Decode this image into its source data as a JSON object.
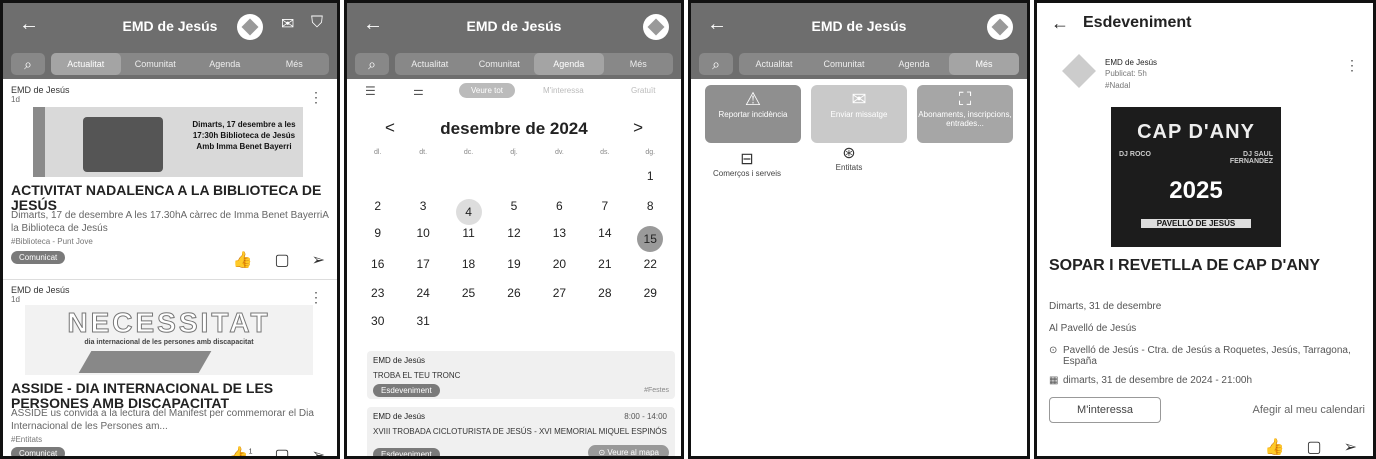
{
  "screens": [
    {
      "title": "EMD de Jesús",
      "tabs": [
        "Actualitat",
        "Comunitat",
        "Agenda",
        "Més"
      ],
      "posts": [
        {
          "author": "EMD de Jesús",
          "time": "1d",
          "image_text": "Dimarts, 17 desembre a les 17:30h Biblioteca de Jesús Amb Imma Benet Bayerri",
          "title": "ACTIVITAT NADALENCA A LA BIBLIOTECA DE JESÚS",
          "desc": "Dimarts, 17 de desembre A les 17.30hA càrrec de Imma Benet BayerriA la Biblioteca de Jesús",
          "tag": "#Biblioteca - Punt Jove",
          "badge": "Comunicat"
        },
        {
          "author": "EMD de Jesús",
          "time": "1d",
          "image_title": "NECESSITAT",
          "image_sub": "dia internacional de les persones amb discapacitat",
          "title": "ASSIDE - DIA INTERNACIONAL DE LES PERSONES AMB DISCAPACITAT",
          "desc": "ASSIDE us convida a la lectura del Manifest per commemorar el Dia Internacional de les Persones am...",
          "tag": "#Entitats",
          "badge": "Comunicat",
          "likes": "1"
        }
      ]
    },
    {
      "title": "EMD de Jesús",
      "tabs": [
        "Actualitat",
        "Comunitat",
        "Agenda",
        "Més"
      ],
      "filters": [
        "Veure tot",
        "M'interessa",
        "Gratuït"
      ],
      "month": "desembre de 2024",
      "dow": [
        "dl.",
        "dt.",
        "dc.",
        "dj.",
        "dv.",
        "ds.",
        "dg."
      ],
      "weeks": [
        [
          "",
          "",
          "",
          "",
          "",
          "",
          "1"
        ],
        [
          "2",
          "3",
          "4",
          "5",
          "6",
          "7",
          "8"
        ],
        [
          "9",
          "10",
          "11",
          "12",
          "13",
          "14",
          "15"
        ],
        [
          "16",
          "17",
          "18",
          "19",
          "20",
          "21",
          "22"
        ],
        [
          "23",
          "24",
          "25",
          "26",
          "27",
          "28",
          "29"
        ],
        [
          "30",
          "31",
          "",
          "",
          "",
          "",
          ""
        ]
      ],
      "events": [
        {
          "author": "EMD de Jesús",
          "title": "TROBA EL TEU TRONC",
          "badge": "Esdeveniment",
          "tag": "#Festes"
        },
        {
          "author": "EMD de Jesús",
          "time": "8:00 - 14:00",
          "title": "XVIII TROBADA CICLOTURISTA DE JESÚS - XVI MEMORIAL MIQUEL ESPINÓS",
          "badge": "Esdeveniment",
          "map": "Veure al mapa"
        }
      ]
    },
    {
      "title": "EMD de Jesús",
      "tabs": [
        "Actualitat",
        "Comunitat",
        "Agenda",
        "Més"
      ],
      "tiles": [
        "Reportar incidència",
        "Enviar missatge",
        "Abonaments, inscripcions, entrades..."
      ],
      "items": [
        "Comerços i serveis",
        "Entitats"
      ]
    },
    {
      "header": "Esdeveniment",
      "author": "EMD de Jesús",
      "published": "Publicat: 5h",
      "tag": "#Nadal",
      "poster_title": "CAP D'ANY",
      "poster_year": "2025",
      "poster_sub": "PAVELLÓ DE JESÚS",
      "poster_dj1": "DJ ROCO",
      "poster_dj2": "DJ SAUL FERNANDEZ",
      "title": "SOPAR I REVETLLA DE CAP D'ANY",
      "date": "Dimarts, 31 de desembre",
      "place": "Al Pavelló de Jesús",
      "address": "Pavelló de Jesús - Ctra. de Jesús a Roquetes, Jesús, Tarragona, España",
      "datetime": "dimarts, 31 de desembre de 2024 - 21:00h",
      "interest": "M'interessa",
      "calendar": "Afegir al meu calendari"
    }
  ]
}
